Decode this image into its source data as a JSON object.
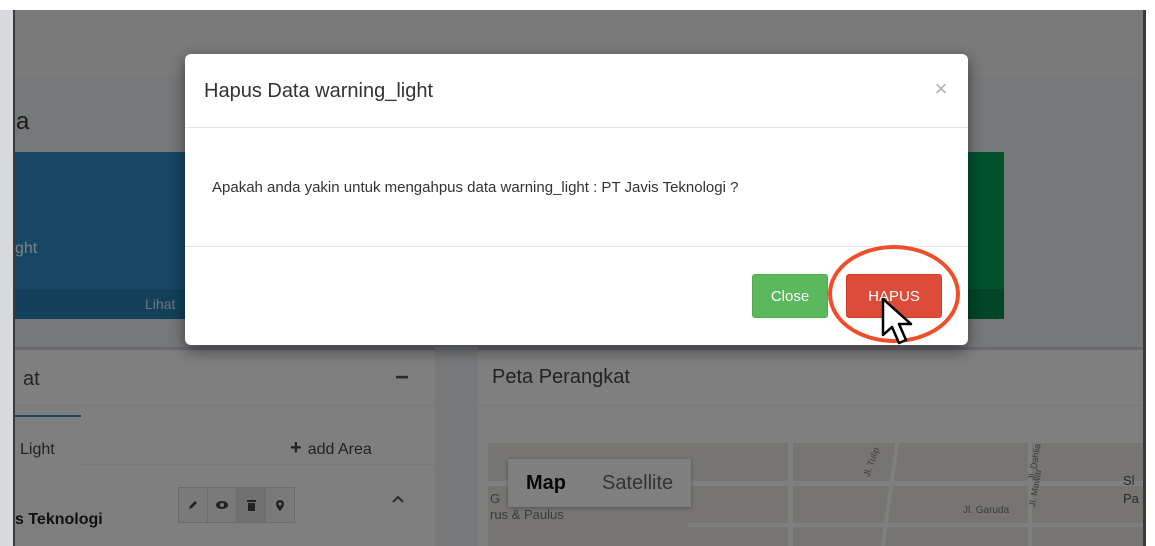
{
  "background": {
    "page_title": "a",
    "info_box_blue": {
      "label": "ght",
      "footer_link": "Lihat"
    },
    "left_panel": {
      "title": "at",
      "collapse_glyph": "−",
      "tab_label": "Light",
      "add_area_label": "add Area",
      "row_name": "s Teknologi",
      "row_actions": [
        "pencil-icon",
        "eye-icon",
        "trash-icon",
        "map-marker-icon"
      ]
    },
    "right_panel": {
      "title": "Peta Perangkat",
      "map_type": {
        "map_label": "Map",
        "satellite_label": "Satellite"
      },
      "map_labels": [
        "G",
        "rus & Paulus",
        "Jl. Garuda",
        "Sl",
        "Pa",
        "Jl. Tulip",
        "Jl. Dahlia",
        "Jl. Mawar"
      ]
    }
  },
  "modal": {
    "title": "Hapus Data warning_light",
    "close_glyph": "×",
    "message": "Apakah anda yakin untuk mengahpus data warning_light : PT Javis Teknologi ?",
    "close_button_label": "Close",
    "delete_button_label": "HAPUS"
  },
  "colors": {
    "delete_button": "#dd4b39",
    "close_button": "#5cb85c",
    "highlight_ring": "#f04e2a",
    "info_blue": "#2c8fc9",
    "info_green": "#00a65a"
  }
}
